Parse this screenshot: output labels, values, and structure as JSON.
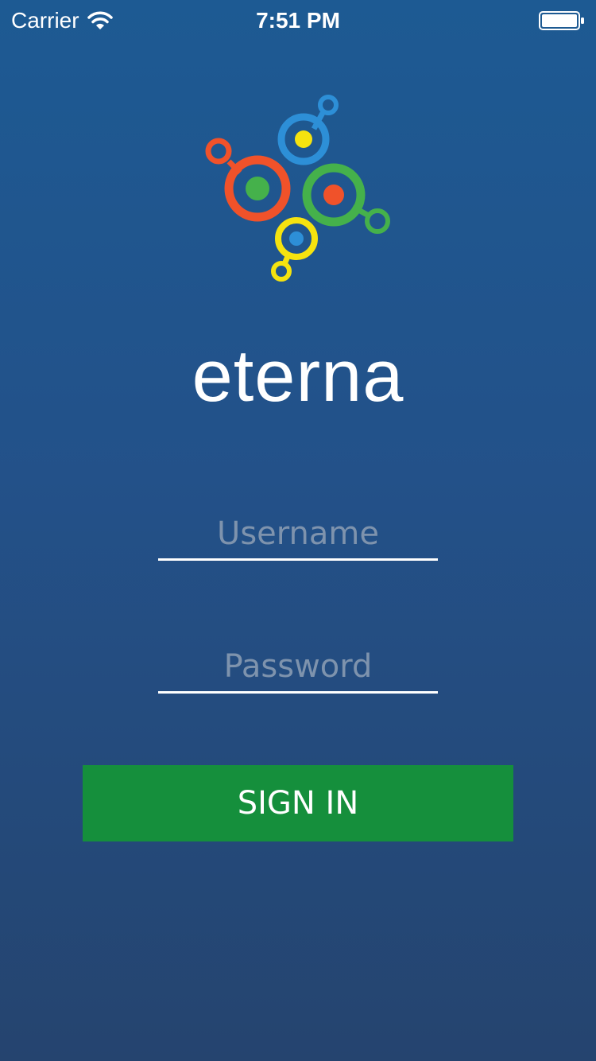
{
  "status_bar": {
    "carrier": "Carrier",
    "time": "7:51 PM",
    "wifi_icon": "wifi-icon",
    "battery_icon": "battery-icon"
  },
  "logo": {
    "icon": "eterna-molecule-logo-icon",
    "colors": {
      "orange": "#f0522a",
      "blue": "#2d8fd7",
      "green": "#45b14b",
      "yellow": "#f5e30f"
    }
  },
  "brand": {
    "name": "eterna"
  },
  "form": {
    "username_placeholder": "Username",
    "username_value": "",
    "password_placeholder": "Password",
    "password_value": "",
    "sign_in_label": "SIGN IN"
  },
  "colors": {
    "background_top": "#1d5a93",
    "background_bottom": "#25446f",
    "button": "#158f3c",
    "placeholder": "#7e93ad"
  }
}
